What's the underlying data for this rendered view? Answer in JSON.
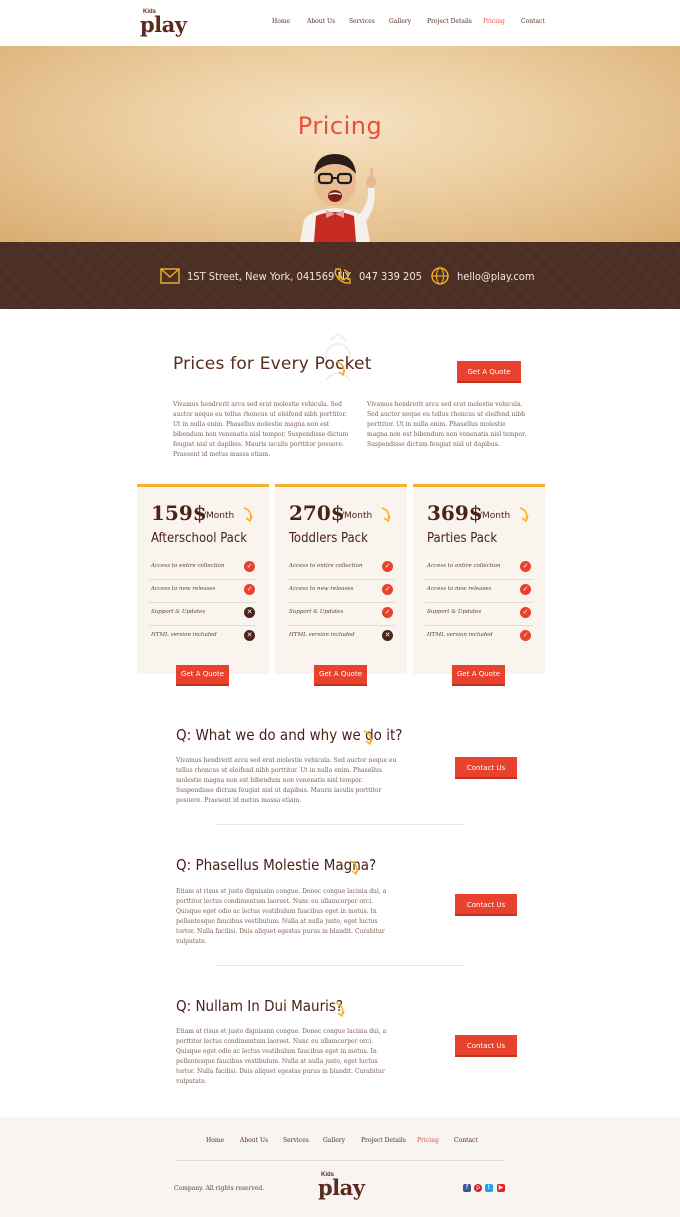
{
  "header": {
    "logo_small": "Kids",
    "logo_word": "play",
    "nav": [
      "Home",
      "About Us",
      "Services",
      "Gallery",
      "Project Details",
      "Pricing",
      "Contact"
    ],
    "active_nav": "Pricing"
  },
  "hero": {
    "title": "Pricing"
  },
  "contact": {
    "address": "1ST Street, New York, 041569 NY",
    "phone": "047 339 205",
    "email": "hello@play.com"
  },
  "intro": {
    "title": "Prices for Every Pocket",
    "quote_label": "Get A Quote",
    "col1": "Vivamus hendrerit arcu sed erat molestie vehicula. Sed auctor neque eu tellus rhoncus ut eleifend nibh porttitor. Ut in nulla enim. Phasellus molestie magna non est bibendum non venenatis nisl tempor. Suspendisse dictum feugiat nisl ut dapibus. Mauris iaculis porttitor posuere. Praesent id metus massa etiam.",
    "col2": "Vivamus hendrerit arcu sed erat molestie vehicula. Sed auctor neque eu tellus rhoncus ut eleifend nibh porttitor. Ut in nulla enim. Phasellus molestie magna non est bibendum non venenatis nisl tempor. Suspendisse dictum feugiat nisl ut dapibus."
  },
  "plans": [
    {
      "price": "159$",
      "period": "/Month",
      "name": "Afterschool Pack",
      "button": "Get A Quote",
      "features": [
        {
          "label": "Access to entire collection",
          "included": true
        },
        {
          "label": "Access to new releases",
          "included": true
        },
        {
          "label": "Support & Updates",
          "included": false
        },
        {
          "label": "HTML version included",
          "included": false
        }
      ]
    },
    {
      "price": "270$",
      "period": "/Month",
      "name": "Toddlers Pack",
      "button": "Get A Quote",
      "features": [
        {
          "label": "Access to entire collection",
          "included": true
        },
        {
          "label": "Access to new releases",
          "included": true
        },
        {
          "label": "Support & Updates",
          "included": true
        },
        {
          "label": "HTML version included",
          "included": false
        }
      ]
    },
    {
      "price": "369$",
      "period": "/Month",
      "name": "Parties Pack",
      "button": "Get A Quote",
      "features": [
        {
          "label": "Access to entire collection",
          "included": true
        },
        {
          "label": "Access to new releases",
          "included": true
        },
        {
          "label": "Support & Updates",
          "included": true
        },
        {
          "label": "HTML version included",
          "included": true
        }
      ]
    }
  ],
  "faq": [
    {
      "question": "Q: What we do and why we do it?",
      "answer": "Vivamus hendrerit arcu sed erat molestie vehicula. Sed auctor neque eu tellus rhoncus ut eleifend nibh porttitor. Ut in nulla enim. Phasellus molestie magna non est bibendum non venenatis nisl tempor. Suspendisse dictum feugiat nisl ut dapibus. Mauris iaculis porttitor posuere. Praesent id metus massa etiam.",
      "button": "Contact Us"
    },
    {
      "question": "Q: Phasellus Molestie Magna?",
      "answer": "Etiam at risus et justo dignissim congue. Donec congue lacinia dui, a porttitor lectus condimentum laoreet. Nunc eu ullamcorper orci. Quisque eget odio ac lectus vestibulum faucibus eget in metus. In pellentesque faucibus vestibulum. Nulla at nulla justo, eget luctus tortor. Nulla facilisi. Duis aliquet egestas purus in blandit. Curabitur vulputate.",
      "button": "Contact Us"
    },
    {
      "question": "Q: Nullam In Dui Mauris?",
      "answer": "Etiam at risus et justo dignissim congue. Donec congue lacinia dui, a porttitor lectus condimentum laoreet. Nunc eu ullamcorper orci. Quisque eget odio ac lectus vestibulum faucibus eget in metus. In pellentesque faucibus vestibulum. Nulla at nulla justo, eget luctus tortor. Nulla facilisi. Duis aliquet egestas purus in blandit. Curabitur vulputate.",
      "button": "Contact Us"
    }
  ],
  "footer": {
    "nav": [
      "Home",
      "About Us",
      "Services",
      "Gallery",
      "Project Details",
      "Pricing",
      "Contact"
    ],
    "copyright": "Company. All rights reserved.",
    "logo_small": "Kids",
    "logo_word": "play",
    "social": [
      {
        "icon": "facebook-icon",
        "color": "#3b5998"
      },
      {
        "icon": "pinterest-icon",
        "color": "#cb2027"
      },
      {
        "icon": "twitter-icon",
        "color": "#1da1f2"
      },
      {
        "icon": "youtube-icon",
        "color": "#e62117"
      }
    ]
  },
  "colors": {
    "accent": "#e8503a",
    "brown": "#4b2e24",
    "yellow": "#f2b126"
  }
}
